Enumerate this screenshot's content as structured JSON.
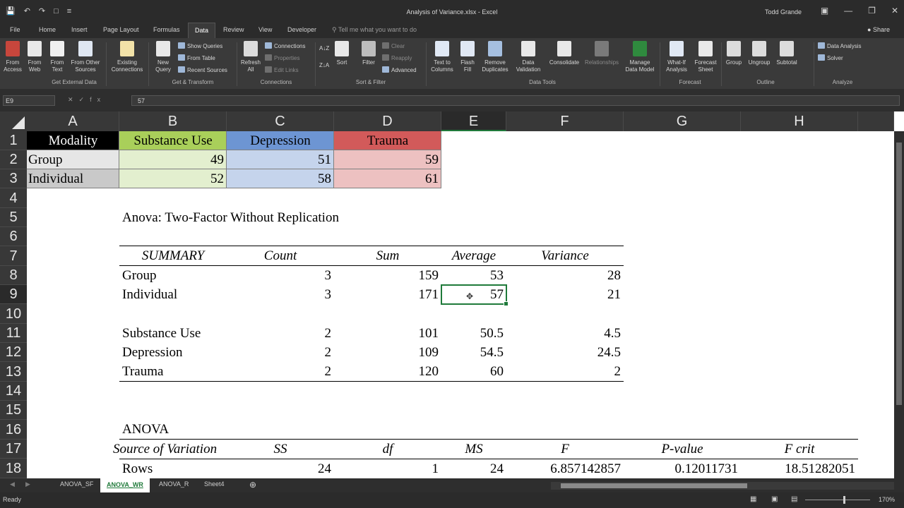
{
  "window": {
    "title": "Analysis of Variance.xlsx - Excel",
    "user": "Todd Grande",
    "qat": [
      "save-icon",
      "undo-icon",
      "redo-icon",
      "new-icon",
      "customize-icon"
    ]
  },
  "tabs": [
    "File",
    "Home",
    "Insert",
    "Page Layout",
    "Formulas",
    "Data",
    "Review",
    "View",
    "Developer"
  ],
  "active_tab": "Data",
  "tell_me": "Tell me what you want to do",
  "share": "Share",
  "ribbon": {
    "get_external_data": {
      "label": "Get External Data",
      "buttons": [
        "From Access",
        "From Web",
        "From Text",
        "From Other Sources",
        "Existing Connections"
      ]
    },
    "get_transform": {
      "label": "Get & Transform",
      "new_query": "New Query",
      "show_queries": "Show Queries",
      "from_table": "From Table",
      "recent_sources": "Recent Sources"
    },
    "connections": {
      "label": "Connections",
      "refresh_all": "Refresh All",
      "connections": "Connections",
      "properties": "Properties",
      "edit_links": "Edit Links"
    },
    "sort_filter": {
      "label": "Sort & Filter",
      "sort": "Sort",
      "filter": "Filter",
      "clear": "Clear",
      "reapply": "Reapply",
      "advanced": "Advanced"
    },
    "data_tools": {
      "label": "Data Tools",
      "buttons": [
        "Text to Columns",
        "Flash Fill",
        "Remove Duplicates",
        "Data Validation",
        "Consolidate",
        "Relationships",
        "Manage Data Model"
      ]
    },
    "forecast": {
      "label": "Forecast",
      "buttons": [
        "What-If Analysis",
        "Forecast Sheet"
      ]
    },
    "outline": {
      "label": "Outline",
      "buttons": [
        "Group",
        "Ungroup",
        "Subtotal"
      ]
    },
    "analyze": {
      "label": "Analyze",
      "data_analysis": "Data Analysis",
      "solver": "Solver"
    }
  },
  "formula_bar": {
    "name_box": "E9",
    "value": "57"
  },
  "columns": [
    "A",
    "B",
    "C",
    "D",
    "E",
    "F",
    "G",
    "H"
  ],
  "rows": [
    "1",
    "2",
    "3",
    "4",
    "5",
    "6",
    "7",
    "8",
    "9",
    "10",
    "11",
    "12",
    "13",
    "14",
    "15",
    "16",
    "17",
    "18"
  ],
  "colors": {
    "header_black": "#000000",
    "substance_green": "#a9cf5a",
    "depression_blue": "#6d95d3",
    "trauma_red": "#d25a5a",
    "group_gray": "#d9d9d9",
    "green_light": "#e3efcf",
    "blue_light": "#c5d4ec",
    "red_light": "#edc1c1",
    "selection": "#1f7a3a"
  },
  "data_table": {
    "headers": [
      "Modality",
      "Substance Use",
      "Depression",
      "Trauma"
    ],
    "rows": [
      [
        "Group",
        "49",
        "51",
        "59"
      ],
      [
        "Individual",
        "52",
        "58",
        "61"
      ]
    ]
  },
  "anova": {
    "title": "Anova: Two-Factor Without Replication",
    "summary_headers": [
      "SUMMARY",
      "Count",
      "Sum",
      "Average",
      "Variance"
    ],
    "summary_rows": [
      [
        "Group",
        "3",
        "159",
        "53",
        "28"
      ],
      [
        "Individual",
        "3",
        "171",
        "57",
        "21"
      ],
      [
        "Substance Use",
        "2",
        "101",
        "50.5",
        "4.5"
      ],
      [
        "Depression",
        "2",
        "109",
        "54.5",
        "24.5"
      ],
      [
        "Trauma",
        "2",
        "120",
        "60",
        "2"
      ]
    ],
    "anova_title": "ANOVA",
    "anova_headers": [
      "Source of Variation",
      "SS",
      "df",
      "MS",
      "F",
      "P-value",
      "F crit"
    ],
    "anova_rows": [
      [
        "Rows",
        "24",
        "1",
        "24",
        "6.857142857",
        "0.12011731",
        "18.51282051"
      ]
    ]
  },
  "sheets": [
    "ANOVA_SF",
    "ANOVA_WR",
    "ANOVA_R",
    "Sheet4"
  ],
  "active_sheet": "ANOVA_WR",
  "status": {
    "ready": "Ready",
    "zoom": "170%"
  }
}
